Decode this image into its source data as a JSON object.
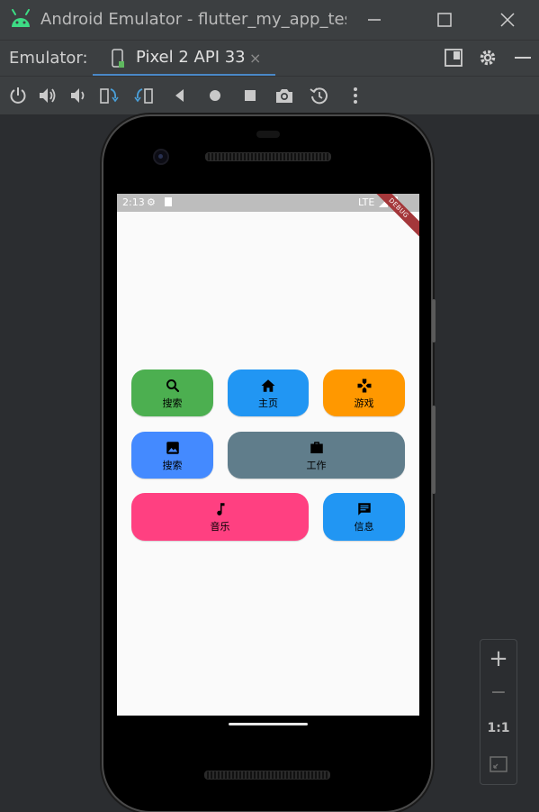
{
  "window": {
    "title": "Android Emulator - flutter_my_app_test",
    "minimize_glyph": "—",
    "maximize_glyph": "☐",
    "close_glyph": "✕"
  },
  "tabbar": {
    "label": "Emulator:",
    "active_tab": "Pixel 2 API 33",
    "close_glyph": "×"
  },
  "toolbar": {
    "tools": [
      "power-icon",
      "volume-up-icon",
      "volume-down-icon",
      "rotate-left-icon",
      "rotate-right-icon",
      "back-icon",
      "home-icon",
      "overview-icon",
      "screenshot-icon",
      "snapshot-icon",
      "more-icon"
    ]
  },
  "status_bar": {
    "time": "2:13",
    "network": "LTE",
    "debug_ribbon": "DEBUG"
  },
  "tiles": [
    {
      "label": "搜索",
      "icon": "search-icon",
      "color": "#4caf50"
    },
    {
      "label": "主页",
      "icon": "home-icon",
      "color": "#2196f3"
    },
    {
      "label": "游戏",
      "icon": "gamepad-icon",
      "color": "#ff9800"
    },
    {
      "label": "搜索",
      "icon": "image-icon",
      "color": "#448aff"
    },
    {
      "label": "工作",
      "icon": "briefcase-icon",
      "color": "#607d8b"
    },
    {
      "label": "音乐",
      "icon": "music-note-icon",
      "color": "#ff4081"
    },
    {
      "label": "信息",
      "icon": "message-icon",
      "color": "#2196f3"
    }
  ],
  "zoom_panel": {
    "zoom_in": "+",
    "zoom_out": "−",
    "actual_size": "1:1"
  }
}
